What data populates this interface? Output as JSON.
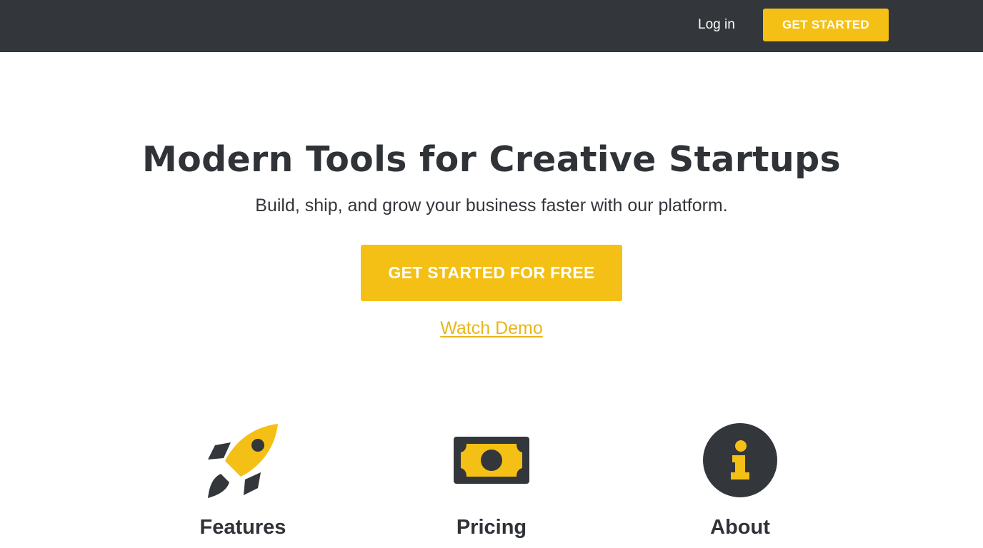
{
  "header": {
    "login_label": "Log in",
    "cta_label": "GET STARTED"
  },
  "hero": {
    "title": "Modern Tools for Creative Startups",
    "subtitle": "Build, ship, and grow your business faster with our platform.",
    "cta_label": "GET STARTED FOR FREE",
    "demo_link_label": "Watch Demo"
  },
  "features": [
    {
      "label": "Features",
      "icon": "rocket-icon"
    },
    {
      "label": "Pricing",
      "icon": "money-bill-icon"
    },
    {
      "label": "About",
      "icon": "info-circle-icon"
    }
  ],
  "colors": {
    "accent": "#f5c015",
    "dark": "#33363b",
    "text": "#2f3337",
    "background": "#ffffff"
  }
}
